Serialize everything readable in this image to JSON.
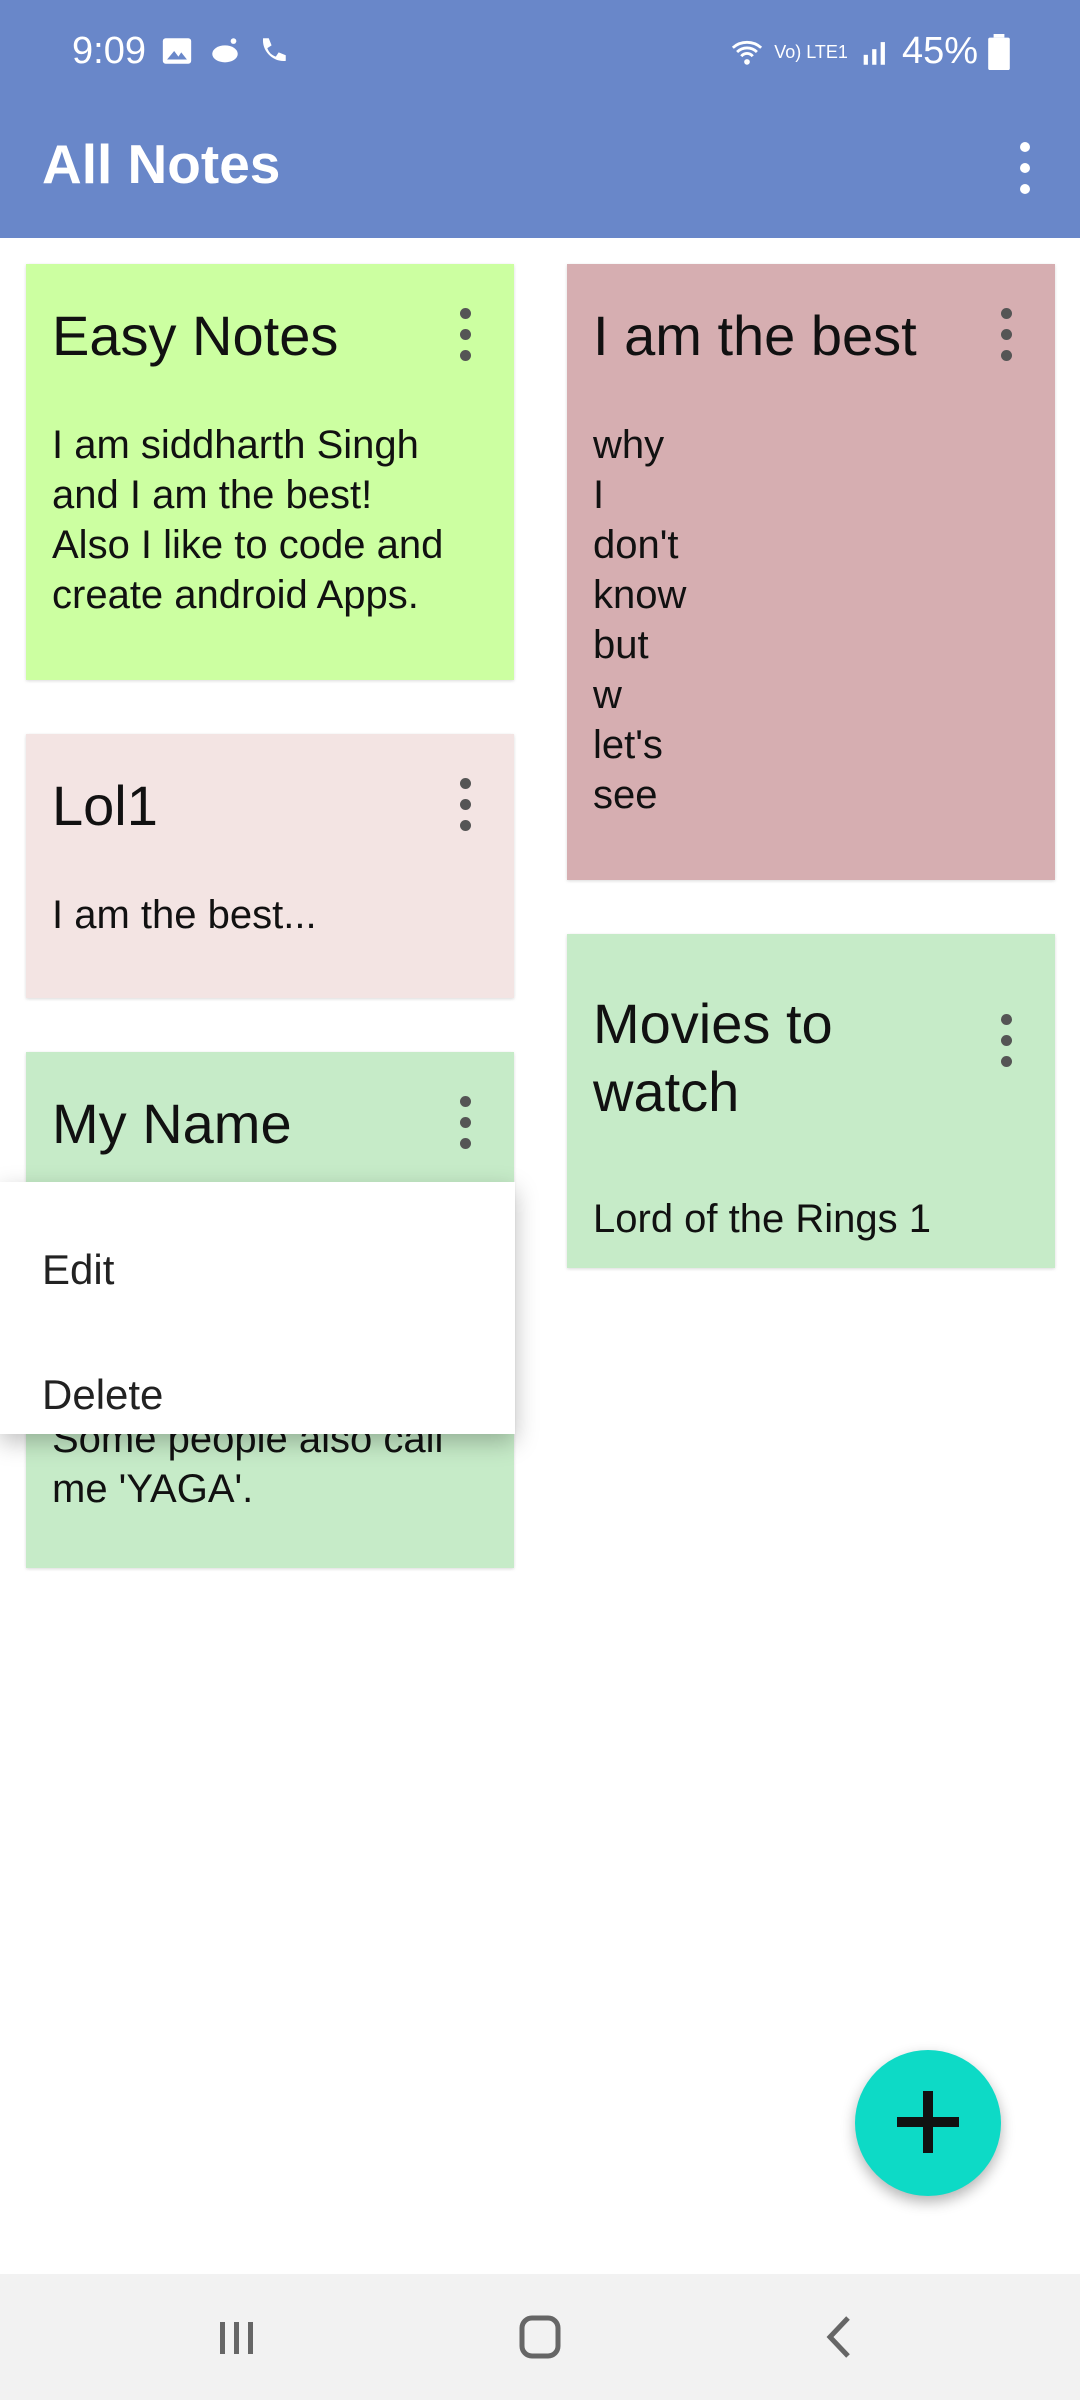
{
  "status_bar": {
    "time": "9:09",
    "battery": "45%",
    "network": "Vo) LTE1"
  },
  "app_bar": {
    "title": "All Notes"
  },
  "notes": [
    {
      "title": "Easy Notes",
      "body": "I am siddharth Singh\nand I am the best!\nAlso I like to code and\ncreate android Apps.",
      "color": "#ccffa1"
    },
    {
      "title": "Lol1",
      "body": "I am the best...",
      "color": "#f3e4e3"
    },
    {
      "title": "My Name",
      "body": "Some people also call\nme 'YAGA'.",
      "color": "#c6ebc8"
    },
    {
      "title": "I am the best",
      "body": "why\nI\ndon't\nknow\nbut\nw\nlet's\nsee",
      "color": "#d6aeb1"
    },
    {
      "title": "Movies to\nwatch",
      "body": "Lord of the Rings 1",
      "color": "#c6ebc8"
    }
  ],
  "popup_menu": {
    "items": [
      "Edit",
      "Delete"
    ]
  },
  "fab": {
    "icon": "plus-icon",
    "color": "#0ddac6"
  },
  "theme": {
    "appbar_color": "#6987c9"
  }
}
